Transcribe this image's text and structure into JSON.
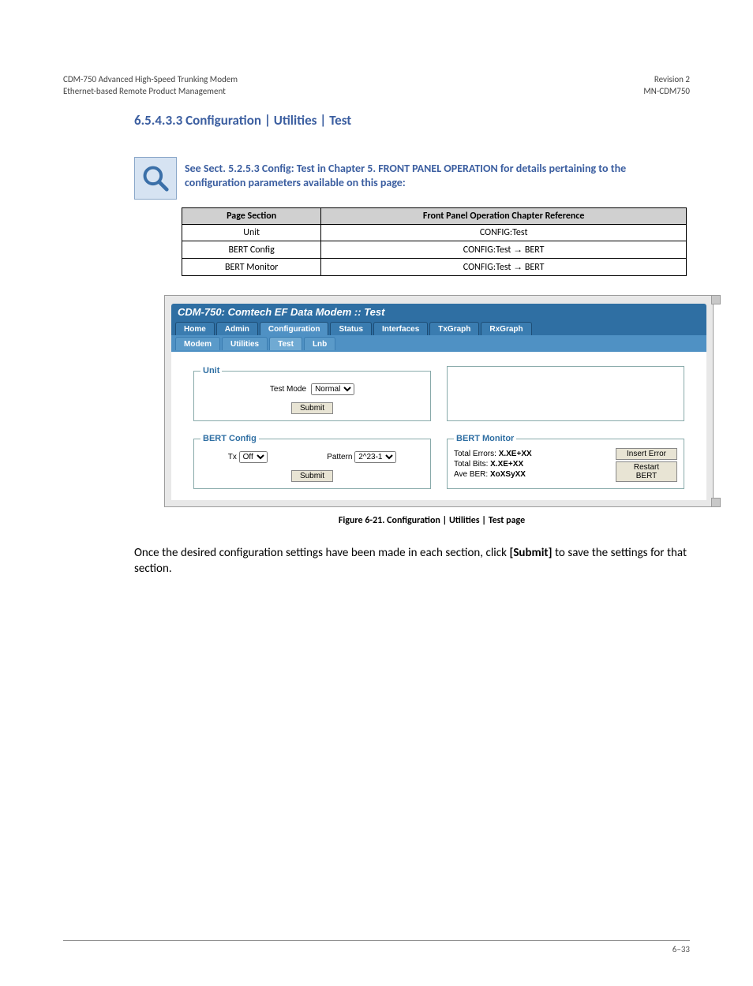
{
  "running_header": {
    "left": "CDM-750 Advanced High-Speed Trunking Modem",
    "right": "Revision 2"
  },
  "running_header2": {
    "left": "Ethernet-based Remote Product Management",
    "right": "MN-CDM750"
  },
  "section_title": "6.5.4.3.3  Configuration | Utilities | Test",
  "head_note": "See Sect. 5.2.5.3 Config: Test in Chapter 5. FRONT PANEL OPERATION for details pertaining to the configuration parameters available on this page:",
  "ref_table": {
    "headers": [
      "Page Section",
      "Front Panel Operation Chapter Reference"
    ],
    "rows": [
      [
        "Unit",
        "CONFIG:Test"
      ],
      [
        "BERT Config",
        "CONFIG:Test → BERT"
      ],
      [
        "BERT Monitor",
        "CONFIG:Test → BERT"
      ]
    ]
  },
  "shot": {
    "title": "CDM-750: Comtech EF Data Modem :: Test",
    "tabs1": [
      "Home",
      "Admin",
      "Configuration",
      "Status",
      "Interfaces",
      "TxGraph",
      "RxGraph"
    ],
    "tabs2": [
      "Modem",
      "Utilities",
      "Test",
      "Lnb"
    ],
    "unit_legend": "Unit",
    "test_mode_label": "Test Mode",
    "test_mode_value": "Normal",
    "submit_label": "Submit",
    "bert_config_legend": "BERT Config",
    "tx_label": "Tx",
    "tx_value": "Off",
    "pattern_label": "Pattern",
    "pattern_value": "2^23-1",
    "bert_monitor_legend": "BERT Monitor",
    "total_errors_label": "Total Errors:",
    "total_errors_value": "X.XE+XX",
    "total_bits_label": "Total Bits:",
    "total_bits_value": "X.XE+XX",
    "ave_ber_label": "Ave BER:",
    "ave_ber_value": "XoXSyXX",
    "insert_error_label": "Insert Error",
    "restart_bert_label": "Restart BERT"
  },
  "caption": "Figure 6-21. Configuration | Utilities | Test page",
  "body": {
    "pre": "Once the desired configuration settings have been made in each section, click ",
    "bold": "[Submit]",
    "post": " to save the settings for that section."
  },
  "footer": {
    "left": "",
    "right": "6–33"
  }
}
